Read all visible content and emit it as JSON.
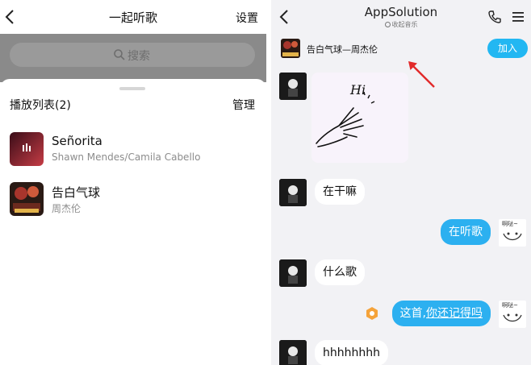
{
  "left": {
    "header": {
      "back": "back-arrow",
      "title": "一起听歌",
      "settings": "设置"
    },
    "search": {
      "placeholder": "搜索"
    },
    "playlist": {
      "title": "播放列表(2)",
      "manage": "管理",
      "songs": [
        {
          "title": "Señorita",
          "artist": "Shawn Mendes/Camila Cabello"
        },
        {
          "title": "告白气球",
          "artist": "周杰伦"
        }
      ]
    }
  },
  "right": {
    "header": {
      "title": "AppSolution",
      "status": "收起音乐"
    },
    "now_playing": {
      "label": "告白气球—周杰伦",
      "join": "加入"
    },
    "messages": [
      {
        "side": "left",
        "type": "sticker",
        "text": "Hi"
      },
      {
        "side": "left",
        "text": "在干嘛"
      },
      {
        "side": "right",
        "text": "在听歌",
        "sticker_label": "啊哒~"
      },
      {
        "side": "left",
        "text": "什么歌"
      },
      {
        "side": "right",
        "text_plain": "这首,",
        "text_link": "你还记得吗",
        "sticker_label": "啊哒~"
      },
      {
        "side": "left",
        "text": "hhhhhhhh"
      }
    ]
  },
  "colors": {
    "accent": "#2cb0f0",
    "join": "#22b7f2",
    "arrow": "#e22a2a",
    "badge": "#f5a33a"
  }
}
